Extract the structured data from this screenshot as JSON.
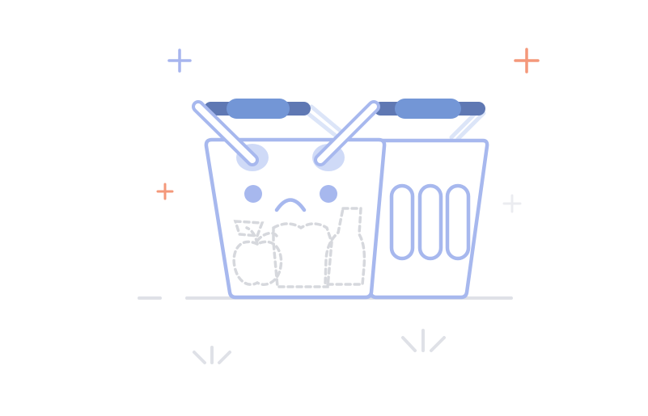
{
  "scene": {
    "subject": "empty-basket-illustration"
  },
  "icons": {
    "basket": "sad-empty-shopping-basket",
    "sparkle": "plus-sparkle",
    "ground": "ground-line",
    "grass": "grass-tuft",
    "groceries": "dashed-grocery-outlines"
  },
  "colors": {
    "primary": "#a7b8ee",
    "primary_light": "#cfdaf7",
    "handle_dark": "#5f78b3",
    "handle_mid": "#7396d6",
    "handle_shadow": "#dce5f8",
    "accent_orange": "#f4987a",
    "accent_blue": "#a7b5ee",
    "neutral": "#dfe1e7",
    "dashed": "#d6d8dd",
    "background": "#ffffff"
  }
}
